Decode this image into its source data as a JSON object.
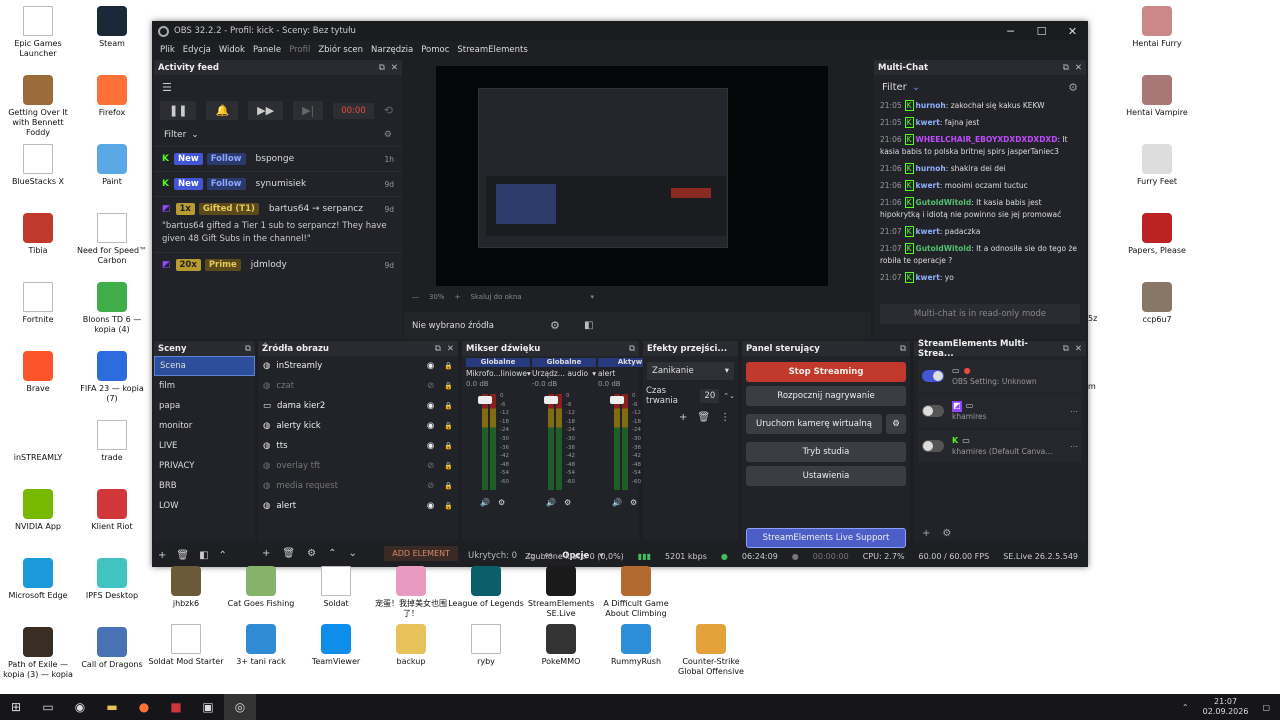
{
  "desktop": {
    "left_icons": [
      {
        "label": "Epic Games Launcher",
        "icon": "doc-icon",
        "color": "#ffffff"
      },
      {
        "label": "Getting Over It with Bennett Foddy",
        "icon": "hammer-icon",
        "color": "#9b6b3a"
      },
      {
        "label": "BlueStacks X",
        "icon": "doc-icon",
        "color": "#ffffff"
      },
      {
        "label": "Tibia",
        "icon": "tibia-icon",
        "color": "#c0392b"
      },
      {
        "label": "Fortnite",
        "icon": "doc-icon",
        "color": "#ffffff"
      },
      {
        "label": "Brave",
        "icon": "brave-icon",
        "color": "#fb542b"
      },
      {
        "label": "inSTREAMLY",
        "icon": "instreamly-icon",
        "color": "#ffffff"
      },
      {
        "label": "NVIDIA App",
        "icon": "nvidia-icon",
        "color": "#76b900"
      },
      {
        "label": "Microsoft Edge",
        "icon": "edge-icon",
        "color": "#1a9ad8"
      },
      {
        "label": "Path of Exile — kopia (3) — kopia",
        "icon": "poe-icon",
        "color": "#3a2e24"
      }
    ],
    "second_icons": [
      {
        "label": "Steam",
        "icon": "steam-icon",
        "color": "#1b2838"
      },
      {
        "label": "Firefox",
        "icon": "firefox-icon",
        "color": "#ff7139"
      },
      {
        "label": "Paint",
        "icon": "paint-icon",
        "color": "#5aa9e6"
      },
      {
        "label": "Need for Speed™ Carbon",
        "icon": "doc-icon",
        "color": "#ffffff"
      },
      {
        "label": "Bloons TD 6 — kopia (4)",
        "icon": "bloons-icon",
        "color": "#3fae49"
      },
      {
        "label": "FIFA 23 — kopia (7)",
        "icon": "fifa-icon",
        "color": "#2d6cdf"
      },
      {
        "label": "trade",
        "icon": "doc-icon",
        "color": "#ffffff"
      },
      {
        "label": "Klient Riot",
        "icon": "riot-icon",
        "color": "#d13639"
      },
      {
        "label": "IPFS Desktop",
        "icon": "ipfs-icon",
        "color": "#41c3c1"
      },
      {
        "label": "Call of Dragons",
        "icon": "cod-icon",
        "color": "#4a73b5"
      }
    ],
    "bottom_row1": [
      {
        "label": "jhbzk6",
        "icon": "thumb-icon",
        "color": "#6b5a3a"
      },
      {
        "label": "Cat Goes Fishing",
        "icon": "cat-icon",
        "color": "#86b36a"
      },
      {
        "label": "Soldat",
        "icon": "doc-icon",
        "color": "#ffffff"
      },
      {
        "label": "宠蛋！我掉美女也围了！",
        "icon": "game-icon",
        "color": "#e89ac0"
      },
      {
        "label": "League of Legends",
        "icon": "lol-icon",
        "color": "#0a5f6b"
      },
      {
        "label": "StreamElements SE.Live",
        "icon": "se-icon",
        "color": "#1a1a1a"
      },
      {
        "label": "A Difficult Game About Climbing",
        "icon": "climb-icon",
        "color": "#b36a30"
      }
    ],
    "bottom_row2": [
      {
        "label": "Soldat Mod Starter",
        "icon": "doc-icon",
        "color": "#ffffff"
      },
      {
        "label": "3+ tani rack",
        "icon": "keyboard-icon",
        "color": "#2e8bd4"
      },
      {
        "label": "TeamViewer",
        "icon": "teamviewer-icon",
        "color": "#0e8ee9"
      },
      {
        "label": "backup",
        "icon": "folder-icon",
        "color": "#e8c25b"
      },
      {
        "label": "ryby",
        "icon": "doc-icon",
        "color": "#ffffff"
      },
      {
        "label": "PokeMMO",
        "icon": "pokemmo-icon",
        "color": "#333333"
      },
      {
        "label": "RummyRush",
        "icon": "rummy-icon",
        "color": "#2c8fd8"
      },
      {
        "label": "Counter-Strike Global Offensive",
        "icon": "csgo-icon",
        "color": "#e4a33a"
      }
    ],
    "right_icons": [
      {
        "label": "Hentai Furry",
        "icon": "thumb-icon",
        "color": "#c88"
      },
      {
        "label": "Hentai Vampire",
        "icon": "thumb-icon",
        "color": "#a77"
      },
      {
        "label": "Furry Feet",
        "icon": "thumb-icon",
        "color": "#ddd"
      },
      {
        "label": "Papers, Please",
        "icon": "papers-icon",
        "color": "#b22"
      },
      {
        "label": "ccp6u7",
        "icon": "thumb-icon",
        "color": "#876"
      }
    ],
    "partial_labels": [
      "5z",
      "m"
    ]
  },
  "obs": {
    "title": "OBS 32.2.2 - Profil: kick - Sceny: Bez tytułu",
    "menu": [
      "Plik",
      "Edycja",
      "Widok",
      "Panele",
      "Profil",
      "Zbiór scen",
      "Narzędzia",
      "Pomoc",
      "StreamElements"
    ],
    "activity": {
      "title": "Activity feed",
      "timer": "00:00",
      "filter": "Filter",
      "items": [
        {
          "platform": "kick",
          "tags": [
            "New",
            "Follow"
          ],
          "name": "bsponge",
          "time": "1h"
        },
        {
          "platform": "kick",
          "tags": [
            "New",
            "Follow"
          ],
          "name": "synumisiek",
          "time": "9d"
        },
        {
          "platform": "twitch",
          "tags": [
            "1x",
            "Gifted (T1)"
          ],
          "name": "bartus64 → serpancz",
          "time": "9d",
          "msg": "\"bartus64 gifted a Tier 1 sub to serpancz! They have given 48 Gift Subs in the channel!\""
        },
        {
          "platform": "twitch",
          "tags": [
            "20x",
            "Prime"
          ],
          "name": "jdmlody",
          "time": "9d"
        }
      ]
    },
    "preview": {
      "zoom": "30%",
      "zoom_mode": "Skaluj do okna",
      "no_source": "Nie wybrano źródła"
    },
    "chat": {
      "title": "Multi-Chat",
      "filter": "Filter",
      "messages": [
        {
          "time": "21:05",
          "user": "hurnoh",
          "color": "#8fb0ff",
          "text": "zakochał się kakus KEKW"
        },
        {
          "time": "21:05",
          "user": "kwert",
          "color": "#8fb0ff",
          "text": "fajna jest"
        },
        {
          "time": "21:06",
          "user": "WHEELCHAIR_EBOYXDXDXDXDXD",
          "color": "#c04cff",
          "text": "It kasia babis to polska britnej spirs jasperTaniec3"
        },
        {
          "time": "21:06",
          "user": "hurnoh",
          "color": "#8fb0ff",
          "text": "shakira dei dei"
        },
        {
          "time": "21:06",
          "user": "kwert",
          "color": "#8fb0ff",
          "text": "mooimi oczami tuctuc"
        },
        {
          "time": "21:06",
          "user": "GutoldWitold",
          "color": "#53c06f",
          "text": "It kasia babis jest hipokrytką i idiotą nie powinno sie jej promować"
        },
        {
          "time": "21:07",
          "user": "kwert",
          "color": "#8fb0ff",
          "text": "padaczka"
        },
        {
          "time": "21:07",
          "user": "GutoldWitold",
          "color": "#53c06f",
          "text": "It a odnosiła sie do tego że robiła te operacje ?"
        },
        {
          "time": "21:07",
          "user": "kwert",
          "color": "#8fb0ff",
          "text": "yo"
        }
      ],
      "readonly": "Multi-chat is in read-only mode"
    },
    "scenes": {
      "title": "Sceny",
      "items": [
        "Scena",
        "film",
        "papa",
        "monitor",
        "LIVE",
        "PRIVACY",
        "BRB",
        "LOW"
      ],
      "selected": 0
    },
    "sources": {
      "title": "Źródła obrazu",
      "items": [
        {
          "name": "inStreamly",
          "visible": true,
          "icon": "browser-icon"
        },
        {
          "name": "czat",
          "visible": false,
          "icon": "browser-icon"
        },
        {
          "name": "dama kier2",
          "visible": true,
          "icon": "window-icon"
        },
        {
          "name": "alerty kick",
          "visible": true,
          "icon": "browser-icon"
        },
        {
          "name": "tts",
          "visible": true,
          "icon": "browser-icon"
        },
        {
          "name": "overlay tft",
          "visible": false,
          "icon": "browser-icon"
        },
        {
          "name": "media request",
          "visible": false,
          "icon": "browser-icon"
        },
        {
          "name": "alert",
          "visible": true,
          "icon": "browser-icon"
        }
      ],
      "add_element": "ADD ELEMENT"
    },
    "mixer": {
      "title": "Mikser dźwięku",
      "channels": [
        {
          "group": "Globalne",
          "name": "Mikrofo...liniowe",
          "db": "0.0 dB"
        },
        {
          "group": "Globalne",
          "name": "Urządz... audio",
          "db": "-0.0 dB"
        },
        {
          "group": "Aktyw",
          "name": "alert",
          "db": "0.0 dB"
        }
      ],
      "scale": [
        "0",
        "-6",
        "-12",
        "-18",
        "-24",
        "-30",
        "-36",
        "-42",
        "-48",
        "-54",
        "-60"
      ],
      "hidden": "Ukrytych: 0",
      "options": "Opcje"
    },
    "transitions": {
      "title": "Efekty przejści...",
      "mode": "Zanikanie",
      "duration_label": "Czas trwania",
      "duration": "20"
    },
    "controls": {
      "title": "Panel sterujący",
      "buttons": [
        "Stop Streaming",
        "Rozpocznij nagrywanie",
        "Uruchom kamerę wirtualną",
        "Tryb studia",
        "Ustawienia"
      ],
      "support": "StreamElements Live Support"
    },
    "multistream": {
      "title": "StreamElements Multi-Strea...",
      "items": [
        {
          "label": "OBS Setting: Unknown",
          "on": true
        },
        {
          "label": "khamires",
          "on": false
        },
        {
          "label": "khamires (Default Canva...",
          "on": false
        }
      ]
    },
    "status": {
      "dropped": "Zgubione klatki 0 (0,0%)",
      "kbps": "5201 kbps",
      "live": "06:24:09",
      "rec": "00:00:00",
      "cpu": "CPU: 2.7%",
      "fps": "60.00 / 60.00 FPS",
      "version": "SE.Live 26.2.5.549"
    }
  },
  "taskbar": {
    "time": "21:07",
    "date": "02.09.2026"
  },
  "colors": {
    "kick": "#53fc18",
    "twitch": "#9146ff",
    "stop": "#c0392b",
    "support": "#5b6fd6"
  }
}
